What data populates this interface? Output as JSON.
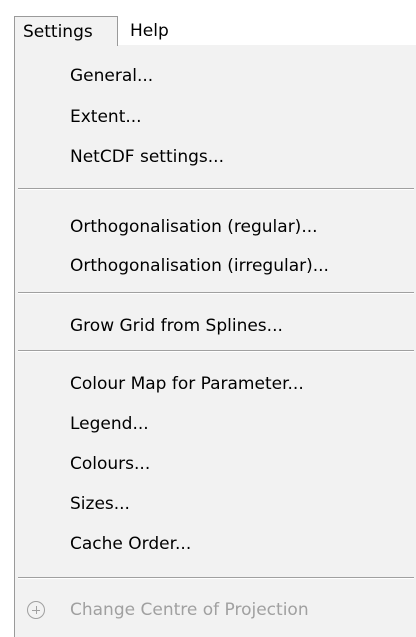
{
  "menubar": {
    "settings_label": "Settings",
    "help_label": "Help"
  },
  "menu": {
    "general": "General...",
    "extent": "Extent...",
    "netcdf": "NetCDF settings...",
    "ortho_regular": "Orthogonalisation (regular)...",
    "ortho_irregular": "Orthogonalisation (irregular)...",
    "grow_grid": "Grow Grid from Splines...",
    "colour_map": "Colour Map for Parameter...",
    "legend": "Legend...",
    "colours": "Colours...",
    "sizes": "Sizes...",
    "cache_order": "Cache Order...",
    "change_centre": "Change Centre of Projection"
  },
  "icons": {
    "change_centre_icon": "plus-circle-icon"
  },
  "colors": {
    "menu_background": "#f2f2f2",
    "disabled_text": "#a0a0a0",
    "separator": "#a0a0a0"
  }
}
